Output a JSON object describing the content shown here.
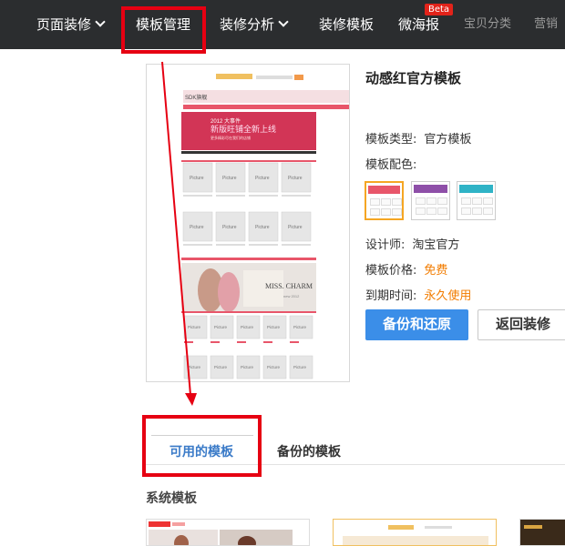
{
  "nav": {
    "items": [
      {
        "label": "页面装修",
        "dropdown": true
      },
      {
        "label": "模板管理",
        "dropdown": false
      },
      {
        "label": "装修分析",
        "dropdown": true
      },
      {
        "label": "装修模板",
        "dropdown": false
      },
      {
        "label": "微海报",
        "dropdown": false
      },
      {
        "label": "宝贝分类",
        "dropdown": false
      },
      {
        "label": "营销",
        "dropdown": false
      }
    ],
    "beta_badge": "Beta"
  },
  "preview": {
    "shop_name": "SDK旗舰",
    "banner_year": "2012 大事件",
    "banner_headline": "新版旺铺全新上线",
    "banner_sub": "更多精彩尽在我们的店铺",
    "product_placeholder": "Picture",
    "promo_text": "MISS. CHARM",
    "promo_sub": "new 2012"
  },
  "template": {
    "title": "动感红官方模板",
    "type_label": "模板类型:",
    "type_value": "官方模板",
    "color_label": "模板配色:",
    "designer_label": "设计师:",
    "designer_value": "淘宝官方",
    "price_label": "模板价格:",
    "price_value": "免费",
    "expire_label": "到期时间:",
    "expire_value": "永久使用",
    "swatches": [
      {
        "accent": "#e8566a",
        "selected": true
      },
      {
        "accent": "#8e4fa8",
        "selected": false
      },
      {
        "accent": "#2fb3c6",
        "selected": false
      }
    ]
  },
  "actions": {
    "backup_restore": "备份和还原",
    "return_decorate": "返回装修"
  },
  "tabs": {
    "available": "可用的模板",
    "backup": "备份的模板"
  },
  "section": {
    "system_templates": "系统模板"
  },
  "colors": {
    "nav_bg": "#2b2d2f",
    "highlight": "#e60012",
    "primary": "#3b8ee8",
    "price": "#f27c00",
    "template_red": "#e8566a"
  }
}
